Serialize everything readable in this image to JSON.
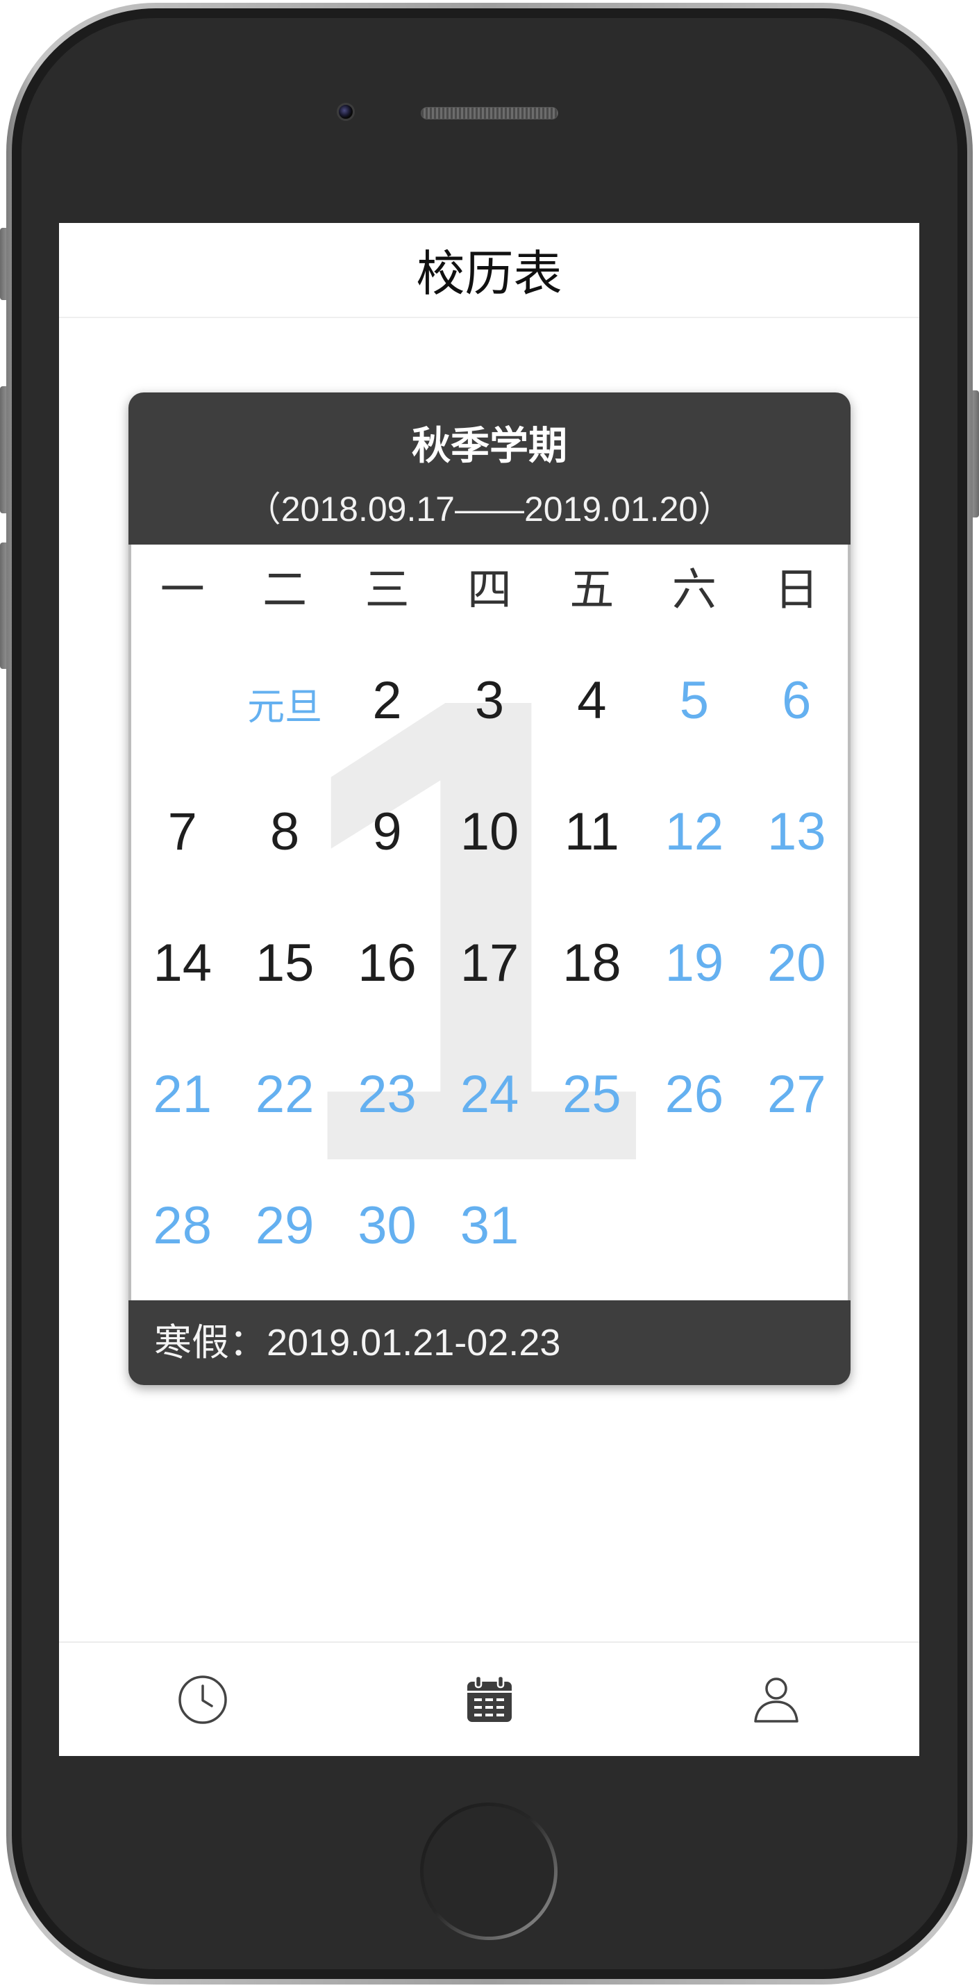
{
  "app": {
    "title": "校历表"
  },
  "semester": {
    "title": "秋季学期",
    "range": "（2018.09.17——2019.01.20）",
    "week_watermark": "1",
    "vacation": "寒假：2019.01.21-02.23"
  },
  "calendar": {
    "weekdays": [
      "一",
      "二",
      "三",
      "四",
      "五",
      "六",
      "日"
    ],
    "weeks": [
      [
        null,
        {
          "label": "元旦",
          "highlight": true,
          "festival": true
        },
        {
          "label": "2",
          "highlight": false
        },
        {
          "label": "3",
          "highlight": false
        },
        {
          "label": "4",
          "highlight": false
        },
        {
          "label": "5",
          "highlight": true
        },
        {
          "label": "6",
          "highlight": true
        }
      ],
      [
        {
          "label": "7",
          "highlight": false
        },
        {
          "label": "8",
          "highlight": false
        },
        {
          "label": "9",
          "highlight": false
        },
        {
          "label": "10",
          "highlight": false
        },
        {
          "label": "11",
          "highlight": false
        },
        {
          "label": "12",
          "highlight": true
        },
        {
          "label": "13",
          "highlight": true
        }
      ],
      [
        {
          "label": "14",
          "highlight": false
        },
        {
          "label": "15",
          "highlight": false
        },
        {
          "label": "16",
          "highlight": false
        },
        {
          "label": "17",
          "highlight": false
        },
        {
          "label": "18",
          "highlight": false
        },
        {
          "label": "19",
          "highlight": true
        },
        {
          "label": "20",
          "highlight": true
        }
      ],
      [
        {
          "label": "21",
          "highlight": true
        },
        {
          "label": "22",
          "highlight": true
        },
        {
          "label": "23",
          "highlight": true
        },
        {
          "label": "24",
          "highlight": true
        },
        {
          "label": "25",
          "highlight": true
        },
        {
          "label": "26",
          "highlight": true
        },
        {
          "label": "27",
          "highlight": true
        }
      ],
      [
        {
          "label": "28",
          "highlight": true
        },
        {
          "label": "29",
          "highlight": true
        },
        {
          "label": "30",
          "highlight": true
        },
        {
          "label": "31",
          "highlight": true
        }
      ]
    ]
  },
  "tabbar": {
    "items": [
      {
        "icon": "clock-icon",
        "active": false
      },
      {
        "icon": "calendar-icon",
        "active": true
      },
      {
        "icon": "user-icon",
        "active": false
      }
    ]
  },
  "colors": {
    "highlight": "#64b0f0",
    "day_text": "#1e1e1e",
    "panel": "#3e3e3e"
  }
}
